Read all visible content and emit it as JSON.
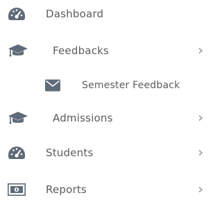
{
  "sidebar": {
    "items": [
      {
        "label": "Dashboard",
        "icon": "dashboard-gauge-icon",
        "has_submenu": false
      },
      {
        "label": "Feedbacks",
        "icon": "graduation-cap-icon",
        "has_submenu": true
      },
      {
        "label": "Semester Feedback",
        "icon": "envelope-icon",
        "has_submenu": false,
        "child_of": "Feedbacks"
      },
      {
        "label": "Admissions",
        "icon": "graduation-cap-icon",
        "has_submenu": true
      },
      {
        "label": "Students",
        "icon": "dashboard-gauge-icon",
        "has_submenu": true
      },
      {
        "label": "Reports",
        "icon": "money-bill-icon",
        "has_submenu": true
      }
    ]
  },
  "colors": {
    "text": "#5c5c5c",
    "icon": "#5f6b78",
    "chevron": "#9a9a9a",
    "background": "#ffffff"
  }
}
